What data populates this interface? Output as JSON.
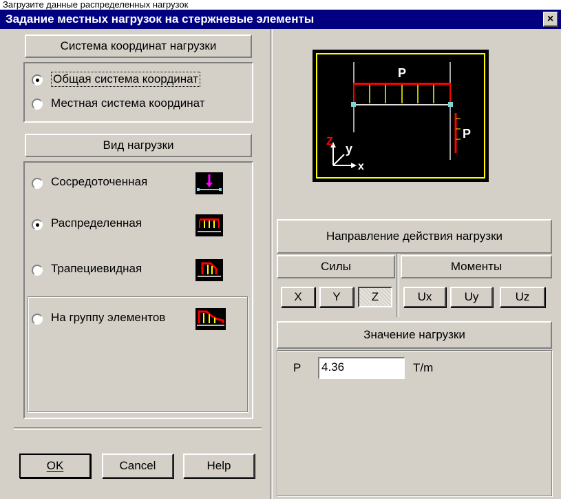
{
  "top_strip": "Загрузите данные распределенных нагрузок",
  "window": {
    "title": "Задание местных нагрузок на стержневые элементы",
    "close_label": "×"
  },
  "coord_system": {
    "header": "Система координат нагрузки",
    "options": [
      {
        "label": "Общая система координат",
        "checked": true
      },
      {
        "label": "Местная  система координат",
        "checked": false
      }
    ]
  },
  "load_type": {
    "header": "Вид нагрузки",
    "options": [
      {
        "label": "Сосредоточенная",
        "icon": "concentrated-load-icon",
        "checked": false
      },
      {
        "label": "Распределенная",
        "icon": "distributed-load-icon",
        "checked": true
      },
      {
        "label": "Трапециевидная",
        "icon": "trapezoidal-load-icon",
        "checked": false
      },
      {
        "label": "На группу элементов",
        "icon": "group-load-icon",
        "checked": false
      }
    ]
  },
  "diagram": {
    "load_label_top": "P",
    "load_label_side": "P",
    "axis_z": "Z",
    "axis_y": "y",
    "axis_x": "x"
  },
  "direction": {
    "header": "Направление действия нагрузки",
    "forces_header": "Силы",
    "moments_header": "Моменты",
    "forces": [
      {
        "label": "X",
        "pressed": false
      },
      {
        "label": "Y",
        "pressed": false
      },
      {
        "label": "Z",
        "pressed": true
      }
    ],
    "moments": [
      {
        "label": "Ux",
        "pressed": false
      },
      {
        "label": "Uy",
        "pressed": false
      },
      {
        "label": "Uz",
        "pressed": false
      }
    ]
  },
  "value": {
    "header": "Значение нагрузки",
    "param": "P",
    "input": "4.36",
    "unit": "T/m"
  },
  "buttons": {
    "ok": "OK",
    "cancel": "Cancel",
    "help": "Help"
  },
  "colors": {
    "title_bg": "#000080",
    "dialog_bg": "#d4d0c8",
    "diagram_frame": "#ffff00",
    "load_red": "#ff0000",
    "load_yellow": "#ffff00",
    "axis_red": "#ff0000"
  }
}
